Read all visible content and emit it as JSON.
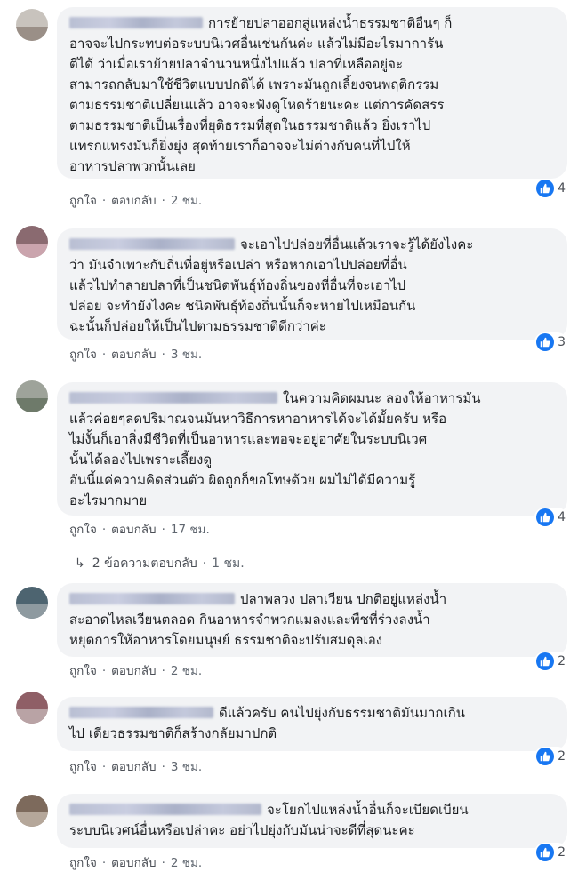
{
  "comments": [
    {
      "text": "การย้ายปลาออกสู่แหล่งน้ำธรรมชาติอื่นๆ ก็\nอาจจะไปกระทบต่อระบบนิเวศอื่นเช่นกันค่ะ แล้วไม่มีอะไรมาการัน\nตีได้ ว่าเมื่อเราย้ายปลาจำนวนหนึ่งไปแล้ว ปลาที่เหลืออยู่จะ\nสามารถกลับมาใช้ชีวิตแบบปกติได้ เพราะมันถูกเลี้ยงจนพฤติกรรม\nตามธรรมชาติเปลี่ยนแล้ว อาจจะฟังดูโหดร้ายนะคะ แต่การคัดสรร\nตามธรรมชาติเป็นเรื่องที่ยุติธรรมที่สุดในธรรมชาติแล้ว ยิ่งเราไป\nแทรกแทรงมันก็ยิ่งยุ่ง สุดท้ายเราก็อาจจะไม่ต่างกับคนที่ไปให้\nอาหารปลาพวกนั้นเลย",
      "like": "ถูกใจ",
      "reply": "ตอบกลับ",
      "time": "2 ชม.",
      "reactions": "4"
    },
    {
      "text": "จะเอาไปปล่อยที่อื่นแล้วเราจะรู้ได้ยังไงคะ\nว่า มันจำเพาะกับถิ่นที่อยู่หรือเปล่า หรือหากเอาไปปล่อยที่อื่น\nแล้วไปทำลายปลาที่เป็นชนิดพันธุ์ท้องถิ่นของที่อื่นที่จะเอาไป\nปล่อย จะทำยังไงคะ ชนิดพันธุ์ท้องถิ่นนั้นก็จะหายไปเหมือนกัน\nฉะนั้นก็ปล่อยให้เป็นไปตามธรรมชาติดีกว่าค่ะ",
      "like": "ถูกใจ",
      "reply": "ตอบกลับ",
      "time": "3 ชม.",
      "reactions": "3"
    },
    {
      "text": "ในความคิดผมนะ ลองให้อาหารมัน\nแล้วค่อยๆลดปริมาณจนมันหาวิธีการหาอาหารได้จะได้มั้ยครับ หรือ\nไม่งั้นก็เอาสิ่งมีชีวิตที่เป็นอาหารและพอจะอยู่อาศัยในระบบนิเวศ\nนั้นได้ลองไปเพราะเลี้ยงดู\nอันนี้แค่ความคิดส่วนตัว ผิดถูกก็ขอโทษด้วย ผมไม่ได้มีความรู้\nอะไรมากมาย",
      "like": "ถูกใจ",
      "reply": "ตอบกลับ",
      "time": "17 ชม.",
      "reactions": "4",
      "replies_label": "2 ข้อความตอบกลับ",
      "replies_time": "1 ชม."
    },
    {
      "text": "ปลาพลวง ปลาเวียน ปกติอยู่แหล่งน้ำ\nสะอาดไหลเวียนตลอด กินอาหารจำพวกแมลงและพืชที่ร่วงลงน้ำ\nหยุดการให้อาหารโดยมนุษย์ ธรรมชาติจะปรับสมดุลเอง",
      "like": "ถูกใจ",
      "reply": "ตอบกลับ",
      "time": "2 ชม.",
      "reactions": "2"
    },
    {
      "text": "ดีแล้วครับ คนไปยุ่งกับธรรมชาติมันมากเกิน\nไป เดียวธรรมชาติก็สร้างกลัยมาปกติ",
      "like": "ถูกใจ",
      "reply": "ตอบกลับ",
      "time": "3 ชม.",
      "reactions": "2"
    },
    {
      "text": "จะโยกไปแหล่งน้ำอื่นก็จะเบียดเบียน\nระบบนิเวศน์อื่นหรือเปล่าคะ อย่าไปยุ่งกับมันน่าจะดีที่สุดนะคะ",
      "like": "ถูกใจ",
      "reply": "ตอบกลับ",
      "time": "2 ชม.",
      "reactions": "2"
    }
  ],
  "colors": {
    "bubble": "#f2f3f5",
    "like_blue": "#1877f2",
    "meta_text": "#606770"
  },
  "avatars": [
    {
      "top": "#c8c3bd",
      "bottom": "#9a8f87"
    },
    {
      "top": "#8a6a70",
      "bottom": "#caa4ad"
    },
    {
      "top": "#9ea39a",
      "bottom": "#6e7a6a"
    },
    {
      "top": "#4d6470",
      "bottom": "#8e9aa0"
    },
    {
      "top": "#8f5f66",
      "bottom": "#b9a3a5"
    },
    {
      "top": "#7d6a5c",
      "bottom": "#b5a79a"
    }
  ]
}
